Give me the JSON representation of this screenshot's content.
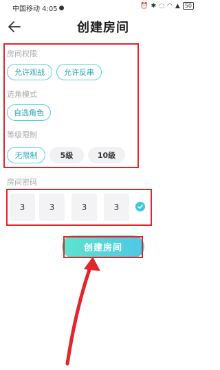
{
  "status_bar": {
    "carrier_time": "中国移动 4:05",
    "battery": "50"
  },
  "header": {
    "title": "创建房间"
  },
  "sections": {
    "room_permission": {
      "label": "房间权限",
      "options": [
        "允许观战",
        "允许反串"
      ]
    },
    "role_mode": {
      "label": "选角模式",
      "options": [
        "自选角色"
      ]
    },
    "level_limit": {
      "label": "等级限制",
      "options": [
        "无限制",
        "5级",
        "10级"
      ],
      "selected": "无限制"
    }
  },
  "password": {
    "label": "房间密码",
    "digits": [
      "3",
      "3",
      "3",
      "3"
    ]
  },
  "actions": {
    "create_label": "创建房间"
  },
  "colors": {
    "accent": "#52d3e3",
    "annotation": "#e3242b"
  }
}
